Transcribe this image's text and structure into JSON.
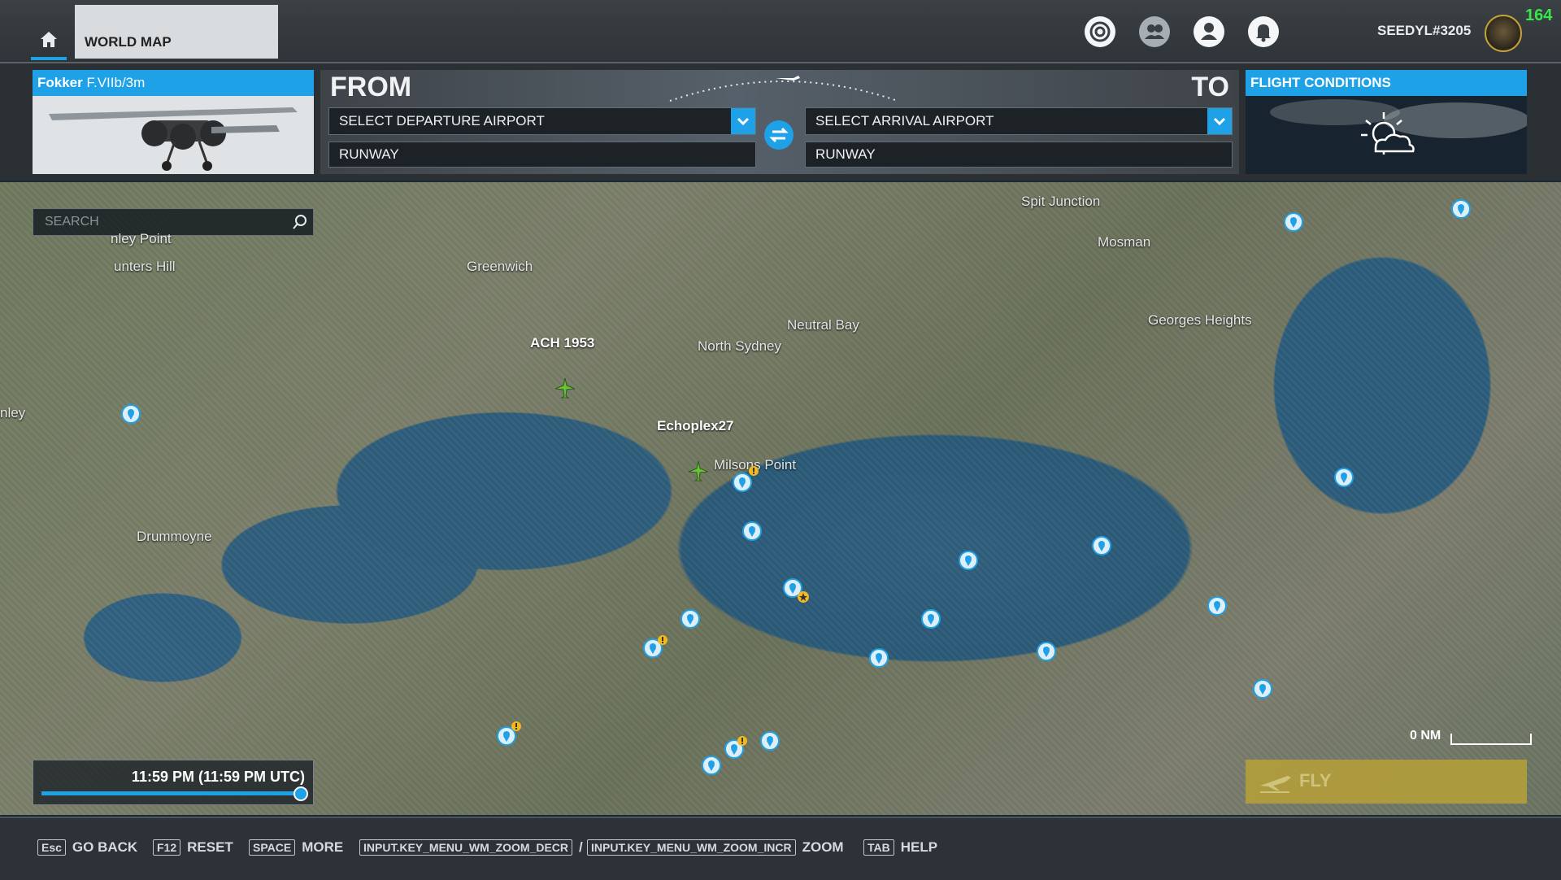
{
  "header": {
    "tab_label": "WORLD MAP",
    "username": "SEEDYL#3205",
    "counter": "164",
    "icons": [
      "home-icon",
      "activity-icon",
      "friends-icon",
      "profile-icon",
      "notification-bell-icon"
    ]
  },
  "aircraft": {
    "make": "Fokker",
    "model": "F.VIIb/3m"
  },
  "flight": {
    "from_label": "FROM",
    "to_label": "TO",
    "departure_placeholder": "SELECT DEPARTURE AIRPORT",
    "arrival_placeholder": "SELECT ARRIVAL AIRPORT",
    "departure_runway": "RUNWAY",
    "arrival_runway": "RUNWAY"
  },
  "conditions": {
    "title": "FLIGHT CONDITIONS",
    "icon": "partly-cloudy-night-icon"
  },
  "map": {
    "search_placeholder": "SEARCH",
    "labels": {
      "greenwich": "Greenwich",
      "spit_junction": "Spit Junction",
      "mosman": "Mosman",
      "neutral_bay": "Neutral Bay",
      "north_sydney": "North Sydney",
      "georges_heights": "Georges Heights",
      "milsons_point": "Milsons Point",
      "drummoyne": "Drummoyne",
      "hunters_hill": "unters Hill",
      "henley_point": "nley Point",
      "henley": "nley",
      "player_ach": "ACH 1953",
      "player_echo": "Echoplex27"
    },
    "scale": "0 NM",
    "time": "11:59 PM (11:59 PM UTC)",
    "time_of_day_fraction": 0.999,
    "fly_label": "FLY"
  },
  "bottom_hints": [
    {
      "key": "Esc",
      "label": "GO BACK"
    },
    {
      "key": "F12",
      "label": "RESET"
    },
    {
      "key": "SPACE",
      "label": "MORE"
    },
    {
      "key": "INPUT.KEY_MENU_WM_ZOOM_DECR",
      "label": "/"
    },
    {
      "key": "INPUT.KEY_MENU_WM_ZOOM_INCR",
      "label": "ZOOM"
    },
    {
      "key": "TAB",
      "label": "HELP"
    }
  ],
  "colors": {
    "accent": "#1ea1e6",
    "fly": "#b49f3c",
    "counter": "#39e64a"
  }
}
